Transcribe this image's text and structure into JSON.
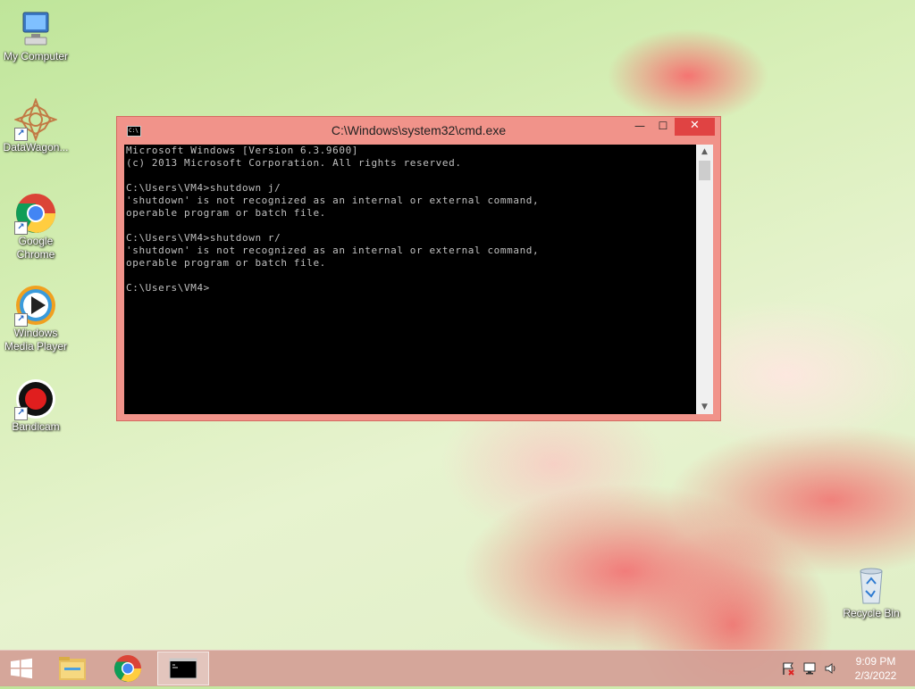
{
  "desktop": {
    "icons": [
      {
        "label": "My Computer",
        "icon": "computer-icon"
      },
      {
        "label": "DataWagon...",
        "icon": "datawagon-icon"
      },
      {
        "label": "Google Chrome",
        "icon": "chrome-icon"
      },
      {
        "label": "Windows Media Player",
        "icon": "media-player-icon"
      },
      {
        "label": "Bandicam",
        "icon": "bandicam-icon"
      },
      {
        "label": "Recycle Bin",
        "icon": "recycle-bin-icon"
      }
    ]
  },
  "cmd": {
    "title": "C:\\Windows\\system32\\cmd.exe",
    "icon_text": "C:\\",
    "buttons": {
      "minimize": "—",
      "maximize": "☐",
      "close": "✕"
    },
    "lines": [
      "Microsoft Windows [Version 6.3.9600]",
      "(c) 2013 Microsoft Corporation. All rights reserved.",
      "",
      "C:\\Users\\VM4>shutdown j/",
      "'shutdown' is not recognized as an internal or external command,",
      "operable program or batch file.",
      "",
      "C:\\Users\\VM4>shutdown r/",
      "'shutdown' is not recognized as an internal or external command,",
      "operable program or batch file.",
      "",
      "C:\\Users\\VM4>"
    ],
    "scroll_up": "▲",
    "scroll_down": "▼"
  },
  "taskbar": {
    "start_icon": "windows-logo-icon",
    "items": [
      {
        "name": "file-explorer",
        "icon": "folder-icon"
      },
      {
        "name": "google-chrome",
        "icon": "chrome-icon"
      },
      {
        "name": "command-prompt",
        "icon": "cmd-icon",
        "active": true
      }
    ],
    "tray": {
      "icons": [
        "action-center-flag-icon",
        "network-icon",
        "volume-icon"
      ],
      "time": "9:09 PM",
      "date": "2/3/2022"
    }
  }
}
